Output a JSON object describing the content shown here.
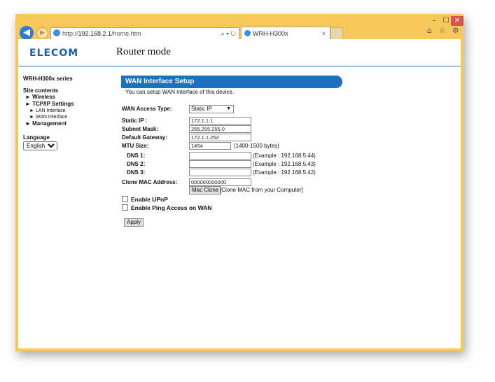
{
  "browser": {
    "address": {
      "prefix": "http://",
      "host": "192.168.2.1",
      "path": "/home.htm",
      "controls": "⌕ ▾ ↻"
    },
    "tab_title": "WRH-H300x",
    "tab_close": "×",
    "window_controls": {
      "minimize": "–",
      "maximize": "☐",
      "close": "✕"
    },
    "right_icons": "⌂ ☆ ⚙"
  },
  "header": {
    "logo": "ELECOM",
    "mode": "Router mode"
  },
  "sidebar": {
    "series": "WRH-H300x series",
    "site_contents": "Site contents",
    "items": [
      {
        "label": "► Wireless"
      },
      {
        "label": "► TCP/IP Settings"
      },
      {
        "label": "► LAN Interface",
        "sub": true
      },
      {
        "label": "► WAN Interface",
        "sub": true
      },
      {
        "label": "► Management"
      }
    ],
    "language_label": "Language",
    "language_value": "English"
  },
  "wan": {
    "title": "WAN Interface Setup",
    "description": "You can setup WAN interface of this device.",
    "access_type_label": "WAN Access Type:",
    "access_type_value": "Static IP",
    "static_ip_label": "Static IP :",
    "static_ip_value": "172.1.1.1",
    "subnet_label": "Subnet Mask:",
    "subnet_value": "255.255.255.0",
    "gateway_label": "Default Gateway:",
    "gateway_value": "172.1.1.254",
    "mtu_label": "MTU Size:",
    "mtu_value": "1454",
    "mtu_note": "(1400-1500 bytes)",
    "dns1_label": "DNS 1:",
    "dns1_value": "",
    "dns1_example": "(Example : 192.168.5.44)",
    "dns2_label": "DNS 2:",
    "dns2_value": "",
    "dns2_example": "(Example : 192.168.5.43)",
    "dns3_label": "DNS 3:",
    "dns3_value": "",
    "dns3_example": "(Example : 192.168.5.42)",
    "clone_mac_label": "Clone MAC Address:",
    "clone_mac_value": "000000000000",
    "mac_clone_button": "Mac Clone",
    "mac_clone_note": "[Clone MAC from your Computer]",
    "upnp_label": "Enable UPnP",
    "ping_label": "Enable Ping Access on WAN",
    "apply_button": "Apply"
  }
}
